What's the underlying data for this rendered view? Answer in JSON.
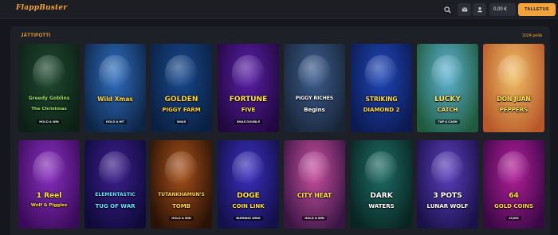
{
  "header": {
    "logo_text": "FlappBuster",
    "search_icon": "search-icon",
    "mail_icon": "mail-icon",
    "profile_icon": "user-icon",
    "balance": "0,00 €",
    "deposit_label": "TALLETUS",
    "accent_color": "#f2a43a"
  },
  "section": {
    "title": "JÄTTIPOTTI",
    "count": "1024 peliä"
  },
  "games": [
    {
      "title": "Greedy Goblins",
      "subtitle": "The Christmas",
      "badge": "HOLD & WIN",
      "bg1": "#1f4a2e",
      "bg2": "#0d1f17",
      "text_color": "#9be35d"
    },
    {
      "title": "Wild Xmas",
      "subtitle": "",
      "badge": "HOLD & HIT",
      "bg1": "#2f6fc2",
      "bg2": "#0d2444",
      "text_color": "#ffd23a"
    },
    {
      "title": "GOLDEN",
      "subtitle": "PIGGY FARM",
      "badge": "XMAS",
      "bg1": "#17498f",
      "bg2": "#0b1f40",
      "text_color": "#ffcf33"
    },
    {
      "title": "FORTUNE",
      "subtitle": "FIVE",
      "badge": "XMAS DOUBLE",
      "bg1": "#5a1fa8",
      "bg2": "#21083f",
      "text_color": "#ffe04a"
    },
    {
      "title": "PIGGY RICHES",
      "subtitle": "Begins",
      "badge": "",
      "bg1": "#3d5d8f",
      "bg2": "#182538",
      "text_color": "#ffffff"
    },
    {
      "title": "STRIKING",
      "subtitle": "DIAMOND 2",
      "badge": "",
      "bg1": "#1f46b8",
      "bg2": "#0c1a52",
      "text_color": "#ffd94a"
    },
    {
      "title": "LUCKY",
      "subtitle": "CATCH",
      "badge": "TAP & CASH",
      "bg1": "#5eb3d6",
      "bg2": "#1f5a3c",
      "text_color": "#ffe35a"
    },
    {
      "title": "DON JUAN",
      "subtitle": "PEPPERS",
      "badge": "",
      "bg1": "#f0c066",
      "bg2": "#b8572a",
      "text_color": "#ffe14a"
    },
    {
      "title": "1 Reel",
      "subtitle": "Wolf & Piggies",
      "badge": "",
      "bg1": "#8a2fc0",
      "bg2": "#3a0b5a",
      "text_color": "#ffde3a"
    },
    {
      "title": "ELEMENTASTIC",
      "subtitle": "TUG OF WAR",
      "badge": "",
      "bg1": "#3d1f8f",
      "bg2": "#0f0a3a",
      "text_color": "#65e0ff"
    },
    {
      "title": "TUTANKHAMUN'S",
      "subtitle": "TOMB",
      "badge": "HOLD & WIN",
      "bg1": "#a8501a",
      "bg2": "#2a1206",
      "text_color": "#ffd24a"
    },
    {
      "title": "DOGE",
      "subtitle": "COIN LINK",
      "badge": "BURNING WINS",
      "bg1": "#3a2fbf",
      "bg2": "#14104a",
      "text_color": "#ffde3a"
    },
    {
      "title": "CITY HEAT",
      "subtitle": "",
      "badge": "HOLD & WIN",
      "bg1": "#c94fa0",
      "bg2": "#3a1544",
      "text_color": "#ffdb4a"
    },
    {
      "title": "DARK",
      "subtitle": "WATERS",
      "badge": "",
      "bg1": "#1f6d66",
      "bg2": "#082522",
      "text_color": "#ffffff"
    },
    {
      "title": "3 POTS",
      "subtitle": "LUNAR WOLF",
      "badge": "",
      "bg1": "#5c3fbf",
      "bg2": "#1a1149",
      "text_color": "#ffffff"
    },
    {
      "title": "64",
      "subtitle": "GOLD COINS",
      "badge": "20,000",
      "bg1": "#b51f9c",
      "bg2": "#3a0845",
      "text_color": "#ffd93a"
    }
  ]
}
